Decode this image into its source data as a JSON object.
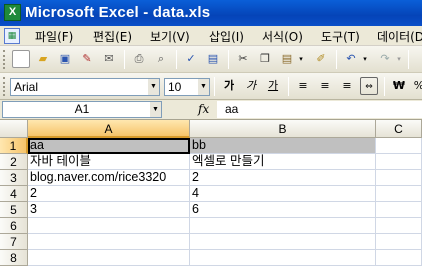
{
  "window": {
    "title": "Microsoft Excel - data.xls"
  },
  "menu": [
    "파일(F)",
    "편집(E)",
    "보기(V)",
    "삽입(I)",
    "서식(O)",
    "도구(T)",
    "데이터(D)"
  ],
  "format_toolbar": {
    "font": "Arial",
    "size": "10"
  },
  "formula_bar": {
    "cell_ref": "A1",
    "fx": "fx",
    "value": "aa"
  },
  "sheet": {
    "columns": [
      "A",
      "B",
      "C"
    ],
    "rows": [
      {
        "n": "1",
        "a": "aa",
        "b": "bb"
      },
      {
        "n": "2",
        "a": "자바 테이블",
        "b": "엑셀로 만들기"
      },
      {
        "n": "3",
        "a": "blog.naver.com/rice3320",
        "b": "2"
      },
      {
        "n": "4",
        "a": "2",
        "b": "4"
      },
      {
        "n": "5",
        "a": "3",
        "b": "6"
      },
      {
        "n": "6",
        "a": "",
        "b": ""
      },
      {
        "n": "7",
        "a": "",
        "b": ""
      },
      {
        "n": "8",
        "a": "",
        "b": ""
      }
    ]
  },
  "colors": {
    "title_bar": "#0a5fd8",
    "selection_header": "#f6c46a",
    "highlight_row": "#c0c0c0"
  }
}
